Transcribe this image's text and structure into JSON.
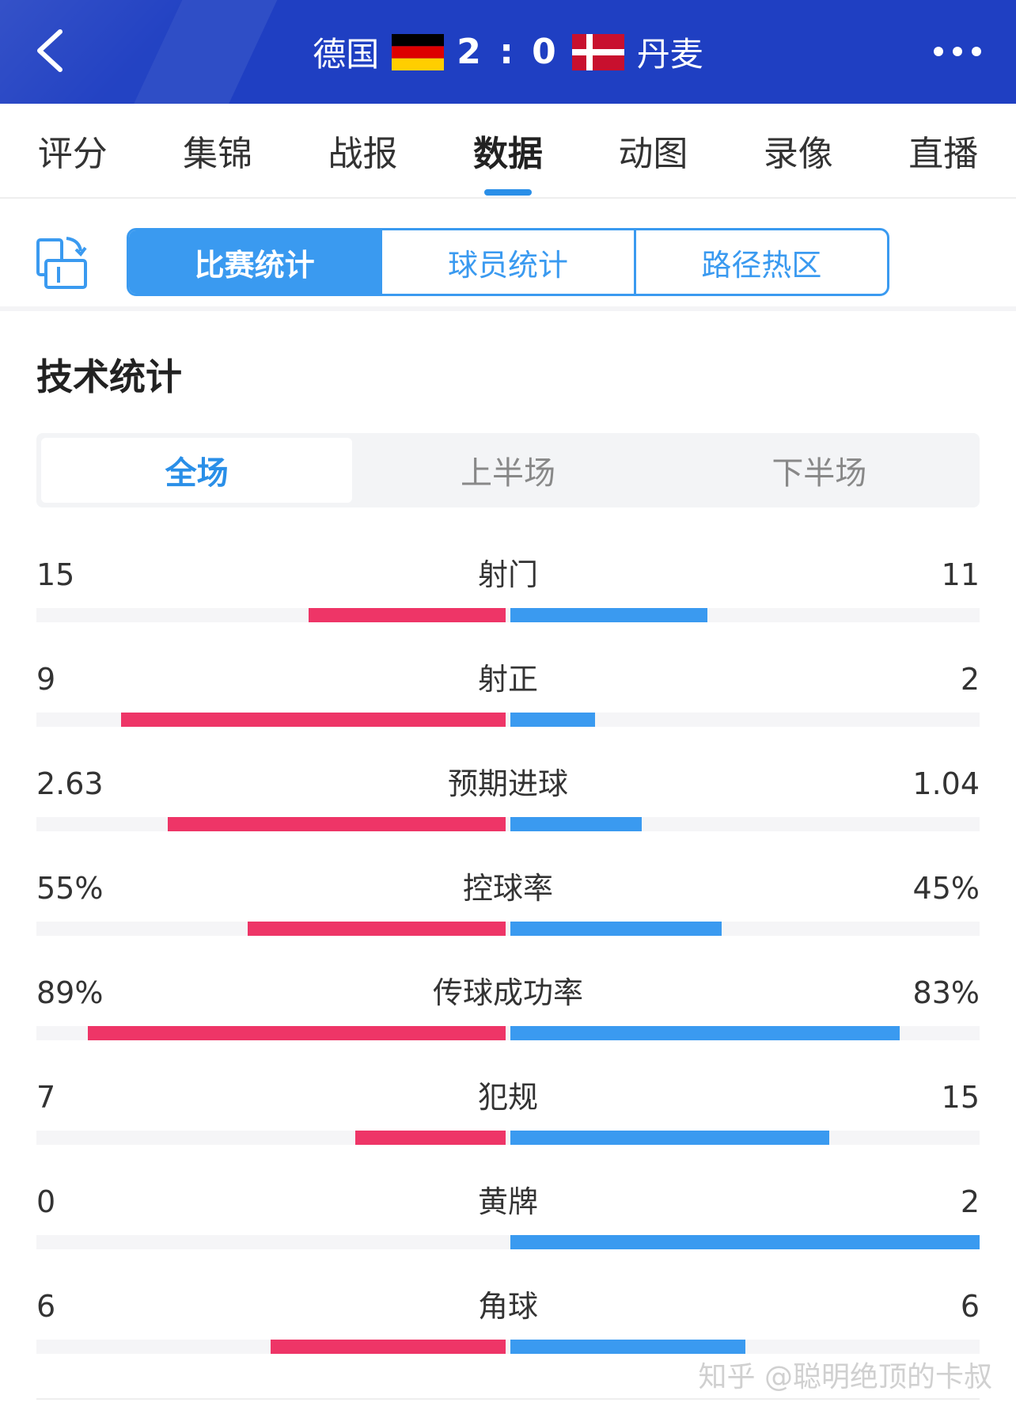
{
  "header": {
    "home_team": "德国",
    "score": "2 : 0",
    "away_team": "丹麦",
    "home_flag_icon": "germany-flag-icon",
    "away_flag_icon": "denmark-flag-icon",
    "bg_color": "#1f3fc2"
  },
  "tabs": [
    {
      "label": "评分",
      "active": false
    },
    {
      "label": "集锦",
      "active": false
    },
    {
      "label": "战报",
      "active": false
    },
    {
      "label": "数据",
      "active": true
    },
    {
      "label": "动图",
      "active": false
    },
    {
      "label": "录像",
      "active": false
    },
    {
      "label": "直播",
      "active": false
    }
  ],
  "subtabs": [
    {
      "label": "比赛统计",
      "active": true
    },
    {
      "label": "球员统计",
      "active": false
    },
    {
      "label": "路径热区",
      "active": false
    }
  ],
  "section_title": "技术统计",
  "periods": [
    {
      "label": "全场",
      "active": true
    },
    {
      "label": "上半场",
      "active": false
    },
    {
      "label": "下半场",
      "active": false
    }
  ],
  "stats": [
    {
      "name": "射门",
      "left": "15",
      "right": "11",
      "left_frac": 0.42,
      "right_frac": 0.42
    },
    {
      "name": "射正",
      "left": "9",
      "right": "2",
      "left_frac": 0.82,
      "right_frac": 0.18
    },
    {
      "name": "预期进球",
      "left": "2.63",
      "right": "1.04",
      "left_frac": 0.72,
      "right_frac": 0.28
    },
    {
      "name": "控球率",
      "left": "55%",
      "right": "45%",
      "left_frac": 0.55,
      "right_frac": 0.45
    },
    {
      "name": "传球成功率",
      "left": "89%",
      "right": "83%",
      "left_frac": 0.89,
      "right_frac": 0.83
    },
    {
      "name": "犯规",
      "left": "7",
      "right": "15",
      "left_frac": 0.32,
      "right_frac": 0.68
    },
    {
      "name": "黄牌",
      "left": "0",
      "right": "2",
      "left_frac": 0.0,
      "right_frac": 1.0
    },
    {
      "name": "角球",
      "left": "6",
      "right": "6",
      "left_frac": 0.5,
      "right_frac": 0.5
    }
  ],
  "colors": {
    "home": "#ee3567",
    "away": "#3a9af0",
    "accent": "#2a8fe8"
  },
  "watermark": "知乎 @聪明绝顶的卡叔"
}
